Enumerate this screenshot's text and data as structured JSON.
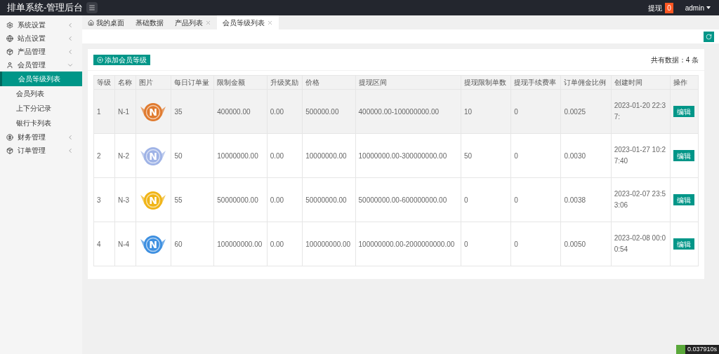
{
  "header": {
    "title": "排单系统-管理后台",
    "withdraw_label": "提现",
    "withdraw_count": "0",
    "user": "admin"
  },
  "sidebar": {
    "items": [
      {
        "label": "系统设置",
        "kind": "gear",
        "expanded": false
      },
      {
        "label": "站点设置",
        "kind": "globe",
        "expanded": false
      },
      {
        "label": "产品管理",
        "kind": "box",
        "expanded": false
      },
      {
        "label": "会员管理",
        "kind": "user",
        "expanded": true,
        "children": [
          {
            "label": "会员等级列表",
            "selected": true
          },
          {
            "label": "会员列表",
            "selected": false
          },
          {
            "label": "上下分记录",
            "selected": false
          },
          {
            "label": "银行卡列表",
            "selected": false
          }
        ]
      },
      {
        "label": "财务管理",
        "kind": "dollar",
        "expanded": false
      },
      {
        "label": "订单管理",
        "kind": "box",
        "expanded": false
      }
    ]
  },
  "tabs": [
    {
      "label": "我的桌面",
      "kind": "home",
      "selected": false
    },
    {
      "label": "基础数据",
      "kind": "plain",
      "selected": false
    },
    {
      "label": "产品列表",
      "kind": "closable",
      "selected": false
    },
    {
      "label": "会员等级列表",
      "kind": "closable",
      "selected": true
    }
  ],
  "toolbar": {
    "add_button": "添加会员等级",
    "total": "共有数据：4 条"
  },
  "table": {
    "columns": [
      "等级",
      "名称",
      "图片",
      "每日订单量",
      "限制金额",
      "升级奖励",
      "价格",
      "提现区间",
      "提现限制单数",
      "提现手续费率",
      "订单佣金比例",
      "创建时间",
      "操作"
    ],
    "rows": [
      {
        "level": "1",
        "name": "N-1",
        "image_text": "N",
        "color": "#e07a2e",
        "daily_orders": "35",
        "limit": "400000.00",
        "upgrade_reward": "0.00",
        "price": "500000.00",
        "withdraw_range": "400000.00-100000000.00",
        "withdraw_limit": "10",
        "fee_rate": "0",
        "commission": "0.0025",
        "created": "2023-01-20 22:37:",
        "action": "编辑",
        "selected": true
      },
      {
        "level": "2",
        "name": "N-2",
        "image_text": "N",
        "color": "#9fb3e6",
        "daily_orders": "50",
        "limit": "10000000.00",
        "upgrade_reward": "0.00",
        "price": "10000000.00",
        "withdraw_range": "10000000.00-300000000.00",
        "withdraw_limit": "50",
        "fee_rate": "0",
        "commission": "0.0030",
        "created": "2023-01-27 10:27:40",
        "action": "编辑",
        "selected": false
      },
      {
        "level": "3",
        "name": "N-3",
        "image_text": "N",
        "color": "#f0b416",
        "daily_orders": "55",
        "limit": "50000000.00",
        "upgrade_reward": "0.00",
        "price": "50000000.00",
        "withdraw_range": "50000000.00-600000000.00",
        "withdraw_limit": "0",
        "fee_rate": "0",
        "commission": "0.0038",
        "created": "2023-02-07 23:53:06",
        "action": "编辑",
        "selected": false
      },
      {
        "level": "4",
        "name": "N-4",
        "image_text": "N",
        "color": "#3d8fe0",
        "daily_orders": "60",
        "limit": "100000000.00",
        "upgrade_reward": "0.00",
        "price": "100000000.00",
        "withdraw_range": "100000000.00-2000000000.00",
        "withdraw_limit": "0",
        "fee_rate": "0",
        "commission": "0.0050",
        "created": "2023-02-08 00:00:54",
        "action": "编辑",
        "selected": false
      }
    ]
  },
  "footer": {
    "timing": "0.037910s"
  }
}
